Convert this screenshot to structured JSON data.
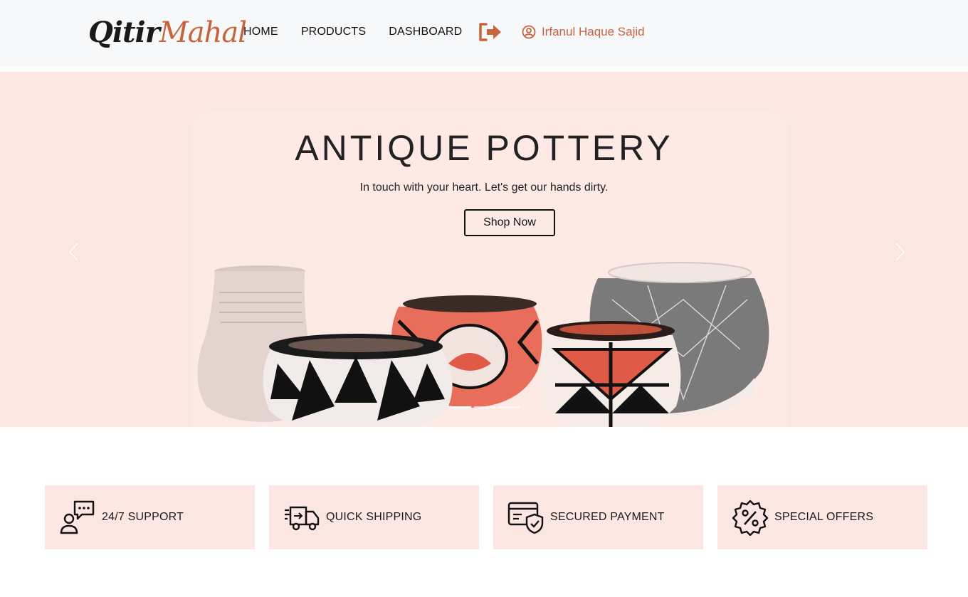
{
  "header": {
    "logo_part1": "Qitir",
    "logo_part2": "Mahal",
    "nav": [
      "HOME",
      "PRODUCTS",
      "DASHBOARD"
    ],
    "user_name": "Irfanul Haque Sajid",
    "logout_icon": "sign-out-icon",
    "user_icon": "user-circle-icon"
  },
  "hero": {
    "title": "ANTIQUE POTTERY",
    "subtitle": "In touch with your heart. Let's get our hands dirty.",
    "button": "Shop Now",
    "slides": 3,
    "active_slide": 1
  },
  "features": [
    {
      "label": "24/7 SUPPORT",
      "icon": "support-chat-icon"
    },
    {
      "label": "QUICK SHIPPING",
      "icon": "delivery-truck-icon"
    },
    {
      "label": "SECURED PAYMENT",
      "icon": "secure-card-icon"
    },
    {
      "label": "SPECIAL OFFERS",
      "icon": "discount-badge-icon"
    }
  ],
  "colors": {
    "accent": "#c8643c",
    "hero_bg": "#fce6e1",
    "card_bg": "#fce6e1",
    "header_bg": "#f7f8fa"
  }
}
